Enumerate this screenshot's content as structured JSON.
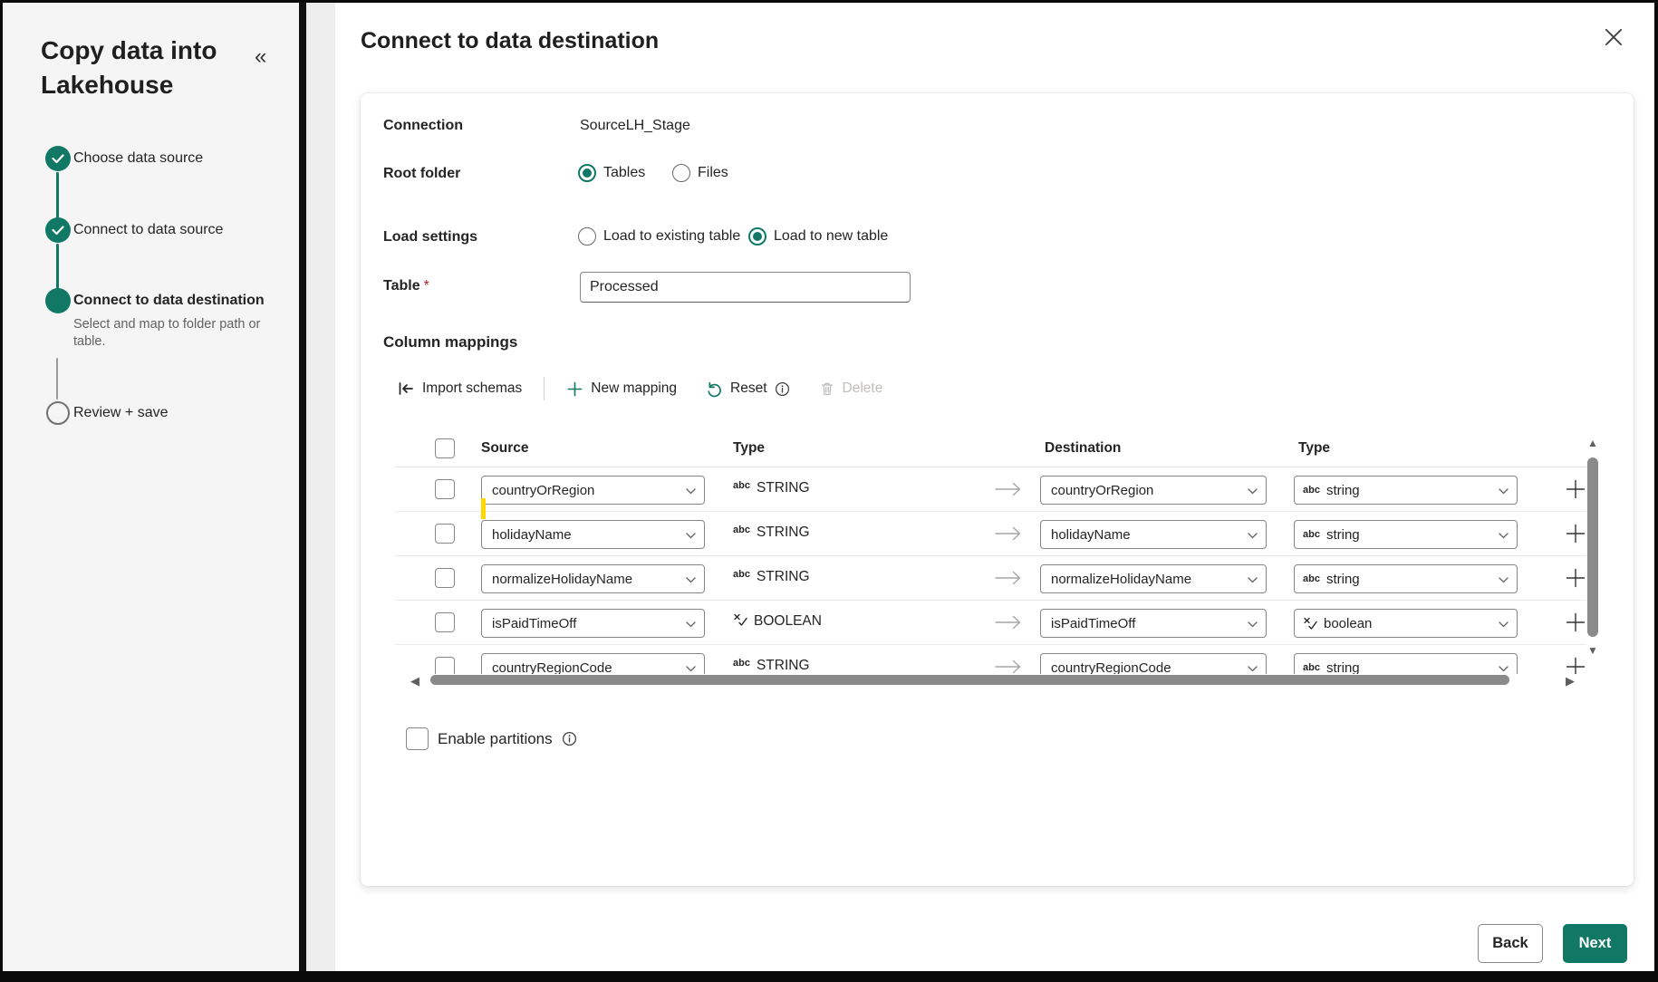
{
  "sidebar": {
    "title": "Copy data into Lakehouse",
    "collapse_icon": "«",
    "steps": [
      {
        "label": "Choose data source",
        "state": "complete"
      },
      {
        "label": "Connect to data source",
        "state": "complete"
      },
      {
        "label": "Connect to data destination",
        "state": "current",
        "description": "Select and map to folder path or table."
      },
      {
        "label": "Review + save",
        "state": "upcoming"
      }
    ]
  },
  "header": {
    "title": "Connect to data destination"
  },
  "form": {
    "connection": {
      "label": "Connection",
      "value": "SourceLH_Stage"
    },
    "root_folder": {
      "label": "Root folder",
      "options": [
        {
          "label": "Tables",
          "selected": true
        },
        {
          "label": "Files",
          "selected": false
        }
      ]
    },
    "load_settings": {
      "label": "Load settings",
      "options": [
        {
          "label": "Load to existing table",
          "selected": false
        },
        {
          "label": "Load to new table",
          "selected": true
        }
      ]
    },
    "table": {
      "label": "Table",
      "required_mark": "*",
      "value": "Processed"
    }
  },
  "mappings": {
    "heading": "Column mappings",
    "toolbar": {
      "import_label": "Import schemas",
      "new_label": "New mapping",
      "reset_label": "Reset",
      "delete_label": "Delete"
    },
    "columns": {
      "source": "Source",
      "source_type": "Type",
      "destination": "Destination",
      "destination_type": "Type"
    },
    "rows": [
      {
        "source": "countryOrRegion",
        "source_type": "STRING",
        "dest": "countryOrRegion",
        "dest_type": "string",
        "kind": "string",
        "highlight": true
      },
      {
        "source": "holidayName",
        "source_type": "STRING",
        "dest": "holidayName",
        "dest_type": "string",
        "kind": "string"
      },
      {
        "source": "normalizeHolidayName",
        "source_type": "STRING",
        "dest": "normalizeHolidayName",
        "dest_type": "string",
        "kind": "string"
      },
      {
        "source": "isPaidTimeOff",
        "source_type": "BOOLEAN",
        "dest": "isPaidTimeOff",
        "dest_type": "boolean",
        "kind": "boolean"
      },
      {
        "source": "countryRegionCode",
        "source_type": "STRING",
        "dest": "countryRegionCode",
        "dest_type": "string",
        "kind": "string"
      }
    ],
    "enable_partitions_label": "Enable partitions",
    "scrollbar": {
      "left": "◀",
      "right": "▶",
      "up": "▲",
      "down": "▼"
    }
  },
  "footer": {
    "back_label": "Back",
    "next_label": "Next"
  },
  "colors": {
    "accent": "#117865",
    "highlight": "#ffd800"
  }
}
